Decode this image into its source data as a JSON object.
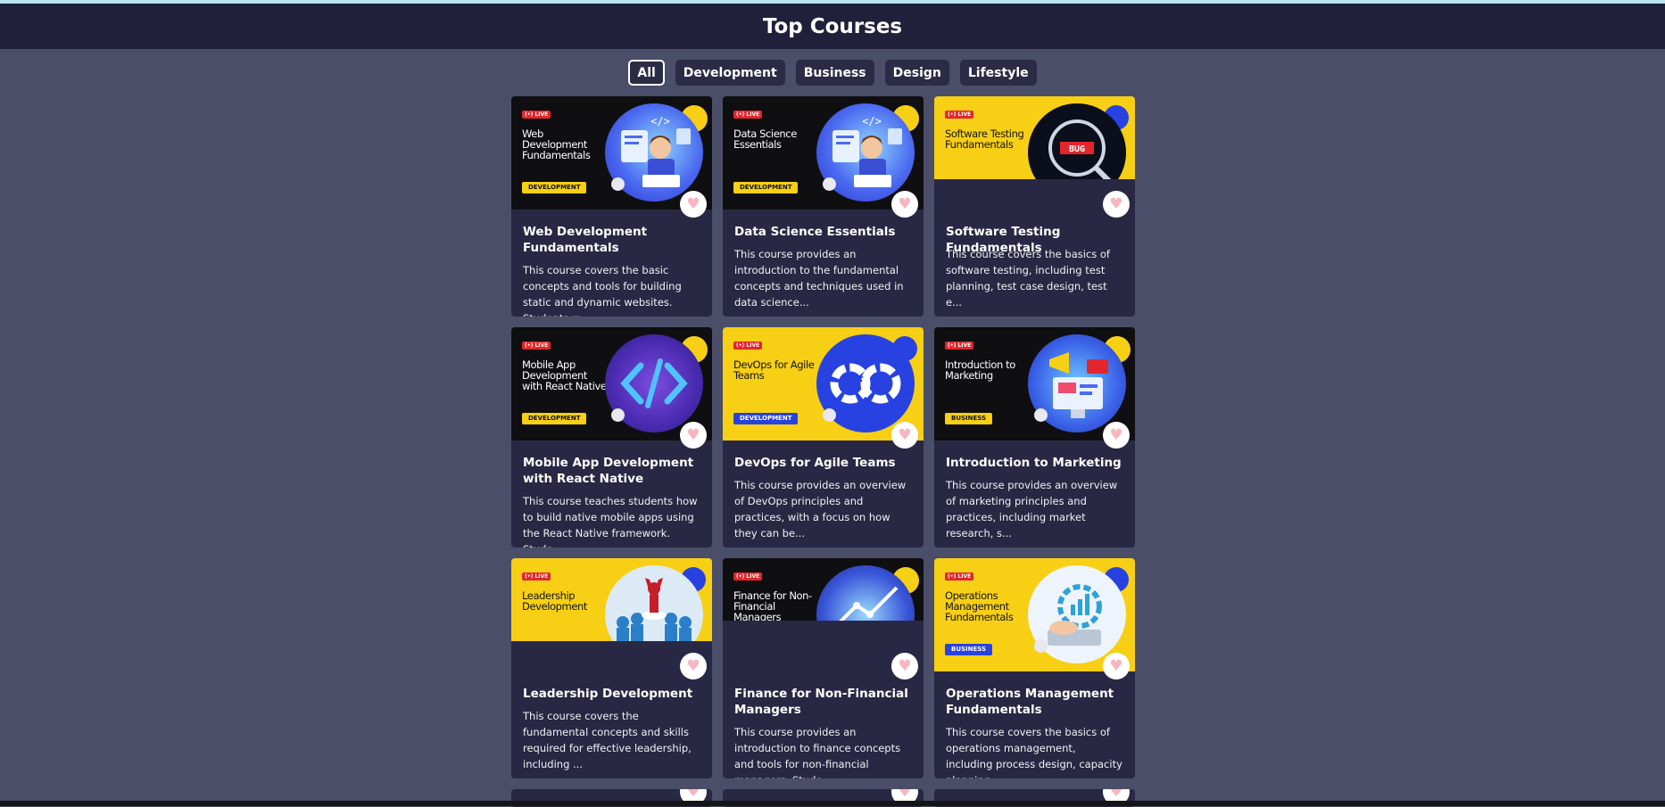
{
  "header": {
    "title": "Top Courses"
  },
  "filters": [
    {
      "label": "All",
      "active": true
    },
    {
      "label": "Development",
      "active": false
    },
    {
      "label": "Business",
      "active": false
    },
    {
      "label": "Design",
      "active": false
    },
    {
      "label": "Lifestyle",
      "active": false
    }
  ],
  "thumb_badge": "(•) LIVE",
  "favorite_icon": "heart-icon",
  "courses": [
    {
      "title": "Web Development Fundamentals",
      "thumb_title": "Web Development Fundamentals",
      "tag": "DEVELOPMENT",
      "description": "This course covers the basic concepts and tools for building static and dynamic websites. Students w...",
      "bg": "#0f0f12"
    },
    {
      "title": "Data Science Essentials",
      "thumb_title": "Data Science Essentials",
      "tag": "DEVELOPMENT",
      "description": "This course provides an introduction to the fundamental concepts and techniques used in data science...",
      "bg": "#0f0f12"
    },
    {
      "title": "Software Testing Fundamentals",
      "thumb_title": "Software Testing Fundamentals",
      "tag": "",
      "description": "This course covers the basics of software testing, including test planning, test case design, test e...",
      "bg": "#f7cf14"
    },
    {
      "title": "Mobile App Development with React Native",
      "thumb_title": "Mobile App Development with React Native",
      "tag": "DEVELOPMENT",
      "description": "This course teaches students how to build native mobile apps using the React Native framework. Stude...",
      "bg": "#0f0f12"
    },
    {
      "title": "DevOps for Agile Teams",
      "thumb_title": "DevOps for Agile Teams",
      "tag": "DEVELOPMENT",
      "description": "This course provides an overview of DevOps principles and practices, with a focus on how they can be...",
      "bg": "#f7cf14"
    },
    {
      "title": "Introduction to Marketing",
      "thumb_title": "Introduction to Marketing",
      "tag": "BUSINESS",
      "description": "This course provides an overview of marketing principles and practices, including market research, s...",
      "bg": "#0f0f12"
    },
    {
      "title": "Leadership Development",
      "thumb_title": "Leadership Development",
      "tag": "",
      "description": "This course covers the fundamental concepts and skills required for effective leadership, including ...",
      "bg": "#f7cf14"
    },
    {
      "title": "Finance for Non-Financial Managers",
      "thumb_title": "Finance for Non-Financial Managers",
      "tag": "",
      "description": "This course provides an introduction to finance concepts and tools for non-financial managers. Stude...",
      "bg": "#0f0f12"
    },
    {
      "title": "Operations Management Fundamentals",
      "thumb_title": "Operations Management Fundamentals",
      "tag": "BUSINESS",
      "description": "This course covers the basics of operations management, including process design, capacity planning,...",
      "bg": "#f7cf14"
    }
  ],
  "colors": {
    "page_bg": "#4a4e68",
    "header_bg": "#20203a",
    "card_bg": "#282844",
    "accent_yellow": "#f7cf14",
    "accent_blue": "#2742e0",
    "live_red": "#e2262c"
  }
}
